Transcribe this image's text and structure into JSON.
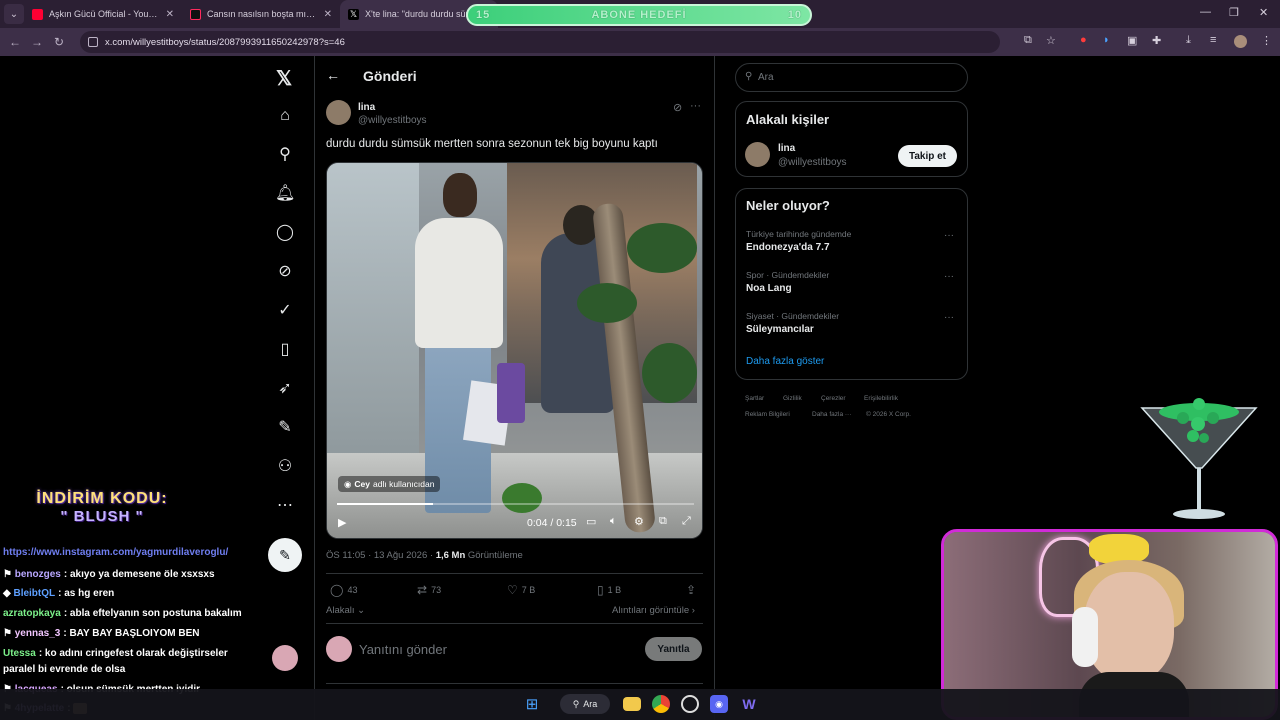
{
  "browser": {
    "tabs": [
      {
        "title": "Aşkın Gücü Official - YouTube",
        "favicon_color": "#ff0033",
        "active": false
      },
      {
        "title": "Cansın nasılsın boşta mısın? —",
        "favicon_color": "#111111",
        "active": false
      },
      {
        "title": "X'te lina: \"durdu durdu sümsük",
        "favicon_color": "#111111",
        "active": true
      }
    ],
    "url": "x.com/willyestitboys/status/2087993911650242978?s=46"
  },
  "overlay": {
    "goal_left": "15",
    "goal_label": "ABONE HEDEFİ",
    "goal_right": "10",
    "discount_line1": "İNDİRİM KODU:",
    "discount_line2": "\" BLUSH \""
  },
  "x": {
    "page_title": "Gönderi",
    "post": {
      "author_name": "lina",
      "author_handle": "@willyestitboys",
      "text": "durdu durdu sümsük mertten sonra sezonun tek big boyunu kaptı",
      "video_attribution_user": "Cey",
      "video_attribution_suffix": "adlı kullanıcıdan",
      "video_time": "0:04 / 0:15",
      "video_progress": 0.27,
      "meta_time": "ÖS 11:05 · 13 Ağu 2026 · ",
      "meta_views": "1,6 Mn",
      "meta_views_label": " Görüntüleme",
      "replies": "43",
      "reposts": "73",
      "likes": "7 B",
      "bookmarks": "1 B",
      "relevant_label": "Alakalı",
      "quotes_label": "Alıntıları görüntüle",
      "reply_placeholder": "Yanıtını gönder",
      "reply_button": "Yanıtla"
    },
    "sidebar": {
      "search_placeholder": "Ara",
      "related_title": "Alakalı kişiler",
      "related_name": "lina",
      "related_handle": "@willyestitboys",
      "follow_label": "Takip et",
      "trends_title": "Neler oluyor?",
      "trends": [
        {
          "category": "Türkiye tarihinde gündemde",
          "name": "Endonezya'da 7.7"
        },
        {
          "category": "Spor · Gündemdekiler",
          "name": "Noa Lang"
        },
        {
          "category": "Siyaset · Gündemdekiler",
          "name": "Süleymancılar"
        }
      ],
      "show_more": "Daha fazla göster",
      "footer": [
        "Şartlar",
        "Gizlilik",
        "Çerezler",
        "Erişilebilirlik",
        "Reklam Bilgileri",
        "Daha fazla ···",
        "© 2026 X Corp."
      ]
    }
  },
  "chat": {
    "top_line": "https://www.instagram.com/yagmurdilaveroglu/",
    "messages": [
      {
        "user": "benozges",
        "text": ": akıyo ya demesene öle xsxsxs",
        "color": "#b9a7ff"
      },
      {
        "user": "BleibtQL",
        "text": ": as hg eren",
        "color": "#5ea0ff"
      },
      {
        "user": "azratopkaya",
        "text": ": abla eftelyanın son postuna bakalım",
        "color": "#7cf08a"
      },
      {
        "user": "yennas_3",
        "text": ": BAY BAY BAŞLOIYOM BEN",
        "color": "#f2c6ff"
      },
      {
        "user": "Utessa",
        "text": ": ko adını cringefest olarak değiştirseler",
        "color": "#7cf08a"
      },
      {
        "user": "",
        "text": "paralel bi evrende de olsa",
        "color": "#ffffff"
      },
      {
        "user": "lacqueas",
        "text": ": olsun sümsük mertten iyidir",
        "color": "#d9a7ff"
      },
      {
        "user": "4hypelatte",
        "text": ":",
        "color": "#b9a7ff"
      }
    ]
  },
  "taskbar": {
    "search_label": "Ara"
  }
}
